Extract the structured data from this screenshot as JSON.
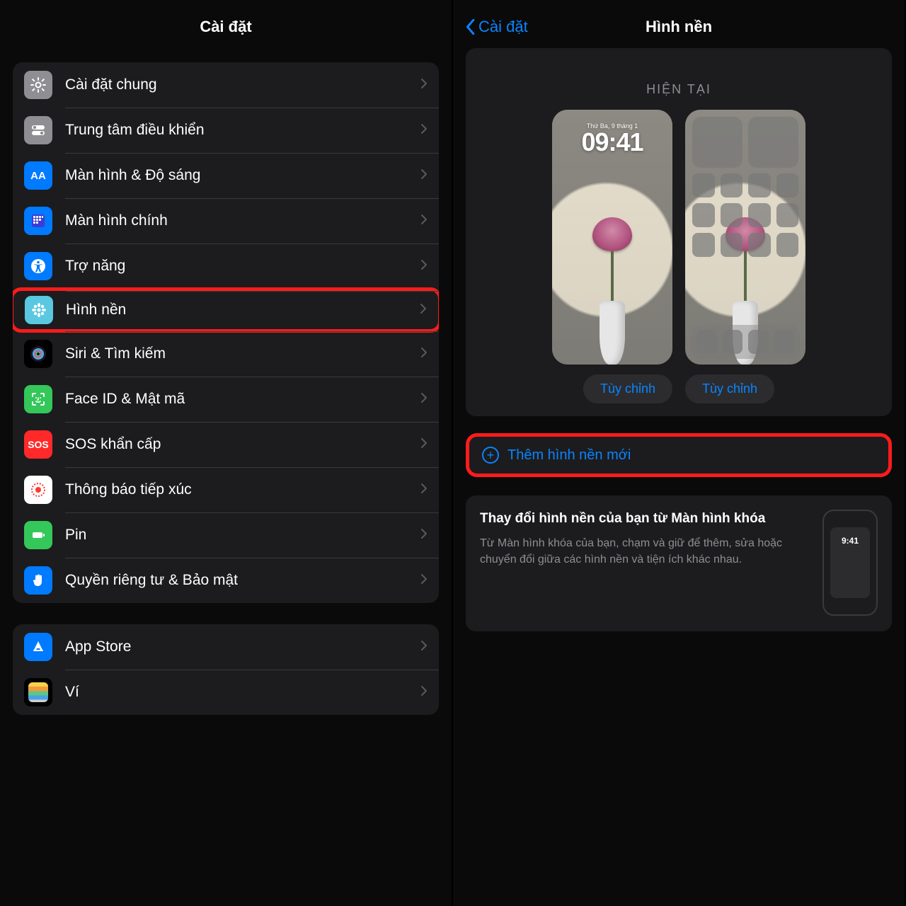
{
  "left": {
    "title": "Cài đặt",
    "groups": [
      [
        {
          "label": "Cài đặt chung",
          "icon": "gear",
          "color": "ic-gray"
        },
        {
          "label": "Trung tâm điều khiển",
          "icon": "switches",
          "color": "ic-gray2"
        },
        {
          "label": "Màn hình & Độ sáng",
          "icon": "AA",
          "color": "ic-blue"
        },
        {
          "label": "Màn hình chính",
          "icon": "apps",
          "color": "ic-blue"
        },
        {
          "label": "Trợ năng",
          "icon": "accessibility",
          "color": "ic-blue"
        },
        {
          "label": "Hình nền",
          "icon": "flower",
          "color": "ic-teal",
          "highlighted": true
        },
        {
          "label": "Siri & Tìm kiếm",
          "icon": "siri",
          "color": "ic-black"
        },
        {
          "label": "Face ID & Mật mã",
          "icon": "faceid",
          "color": "ic-green"
        },
        {
          "label": "SOS khẩn cấp",
          "icon": "SOS",
          "color": "ic-red"
        },
        {
          "label": "Thông báo tiếp xúc",
          "icon": "exposure",
          "color": "ic-white"
        },
        {
          "label": "Pin",
          "icon": "battery",
          "color": "ic-green"
        },
        {
          "label": "Quyền riêng tư & Bảo mật",
          "icon": "hand",
          "color": "ic-blue"
        }
      ],
      [
        {
          "label": "App Store",
          "icon": "appstore",
          "color": "ic-blue"
        },
        {
          "label": "Ví",
          "icon": "wallet",
          "color": "wallet"
        }
      ]
    ]
  },
  "right": {
    "back": "Cài đặt",
    "title": "Hình nền",
    "current_label": "HIỆN TẠI",
    "lock_date": "Thứ Ba, 9 tháng 1",
    "lock_time": "09:41",
    "customize": "Tùy chỉnh",
    "add_new": "Thêm hình nền mới",
    "tip_title": "Thay đổi hình nền của bạn từ Màn hình khóa",
    "tip_body": "Từ Màn hình khóa của bạn, chạm và giữ để thêm, sửa hoặc chuyển đổi giữa các hình nền và tiện ích khác nhau.",
    "tip_phone_time": "9:41"
  }
}
